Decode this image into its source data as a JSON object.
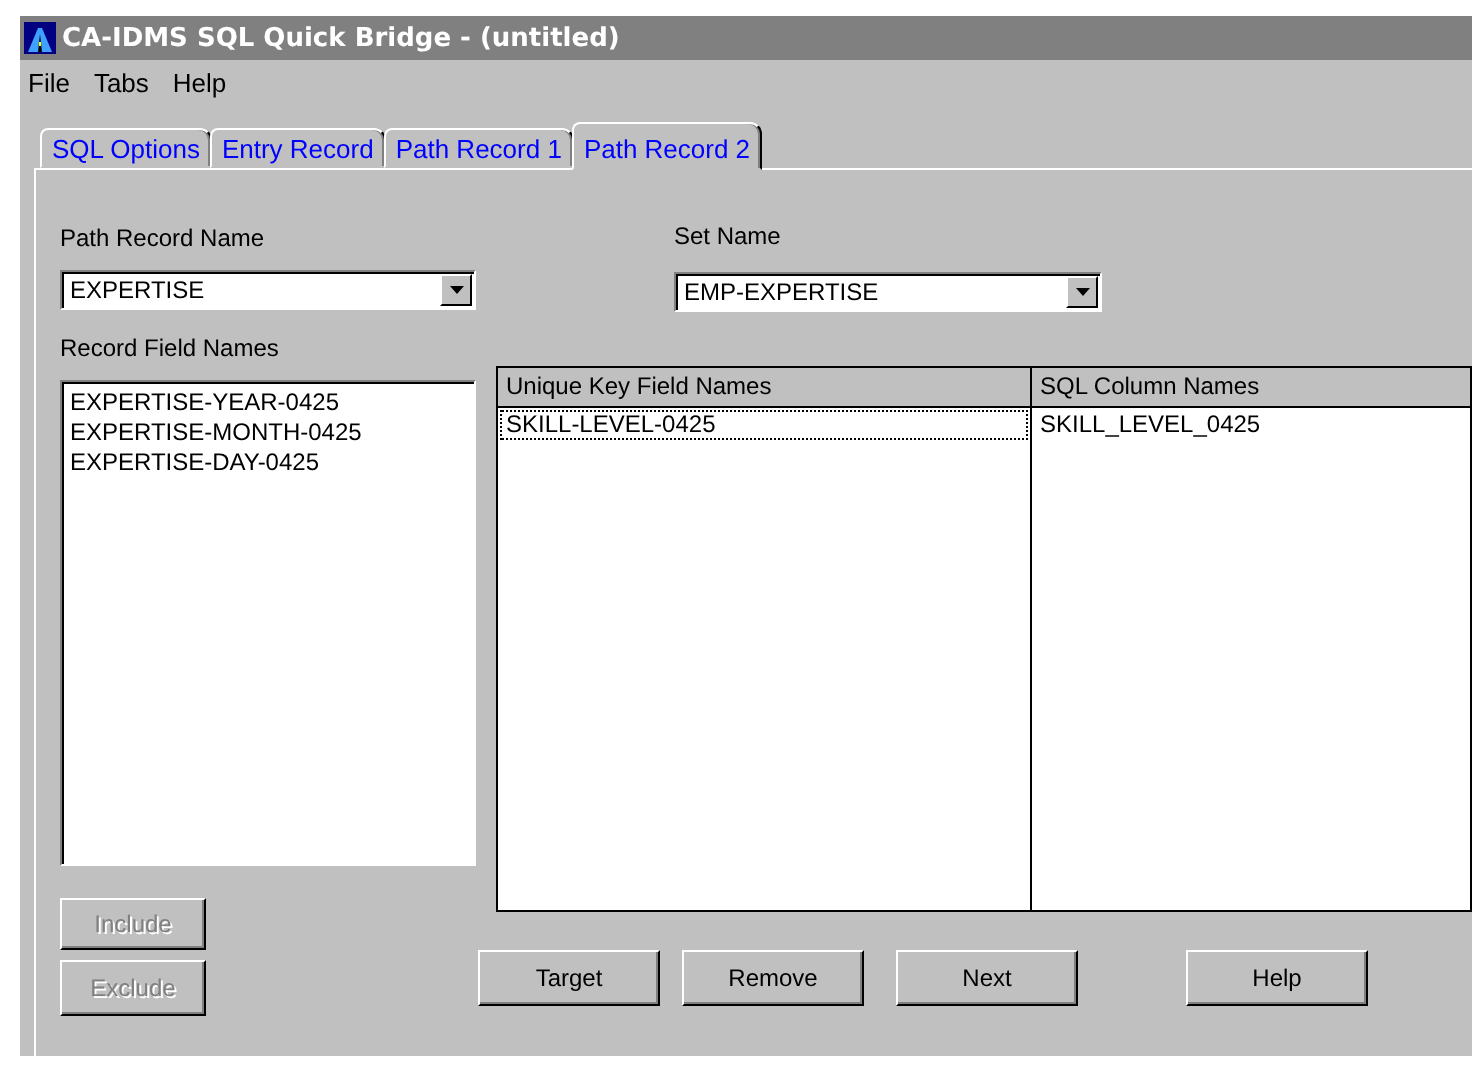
{
  "window": {
    "title": "CA-IDMS SQL Quick Bridge - (untitled)"
  },
  "menu": [
    "File",
    "Tabs",
    "Help"
  ],
  "tabs": [
    {
      "label": "SQL Options",
      "selected": false
    },
    {
      "label": "Entry Record",
      "selected": false
    },
    {
      "label": "Path Record 1",
      "selected": false
    },
    {
      "label": "Path Record 2",
      "selected": true
    }
  ],
  "path_record_name": {
    "label": "Path Record Name",
    "value": "EXPERTISE"
  },
  "set_name": {
    "label": "Set Name",
    "value": "EMP-EXPERTISE"
  },
  "record_field_names": {
    "label": "Record Field Names",
    "items": [
      "EXPERTISE-YEAR-0425",
      "EXPERTISE-MONTH-0425",
      "EXPERTISE-DAY-0425"
    ]
  },
  "key_table": {
    "columns": [
      "Unique Key Field Names",
      "SQL Column Names"
    ],
    "rows": [
      {
        "cells": [
          "SKILL-LEVEL-0425",
          "SKILL_LEVEL_0425"
        ],
        "focused": true
      }
    ]
  },
  "side_buttons": [
    {
      "label": "Include",
      "disabled": true
    },
    {
      "label": "Exclude",
      "disabled": true
    }
  ],
  "buttons": [
    "Target",
    "Remove",
    "Next",
    "Help"
  ]
}
